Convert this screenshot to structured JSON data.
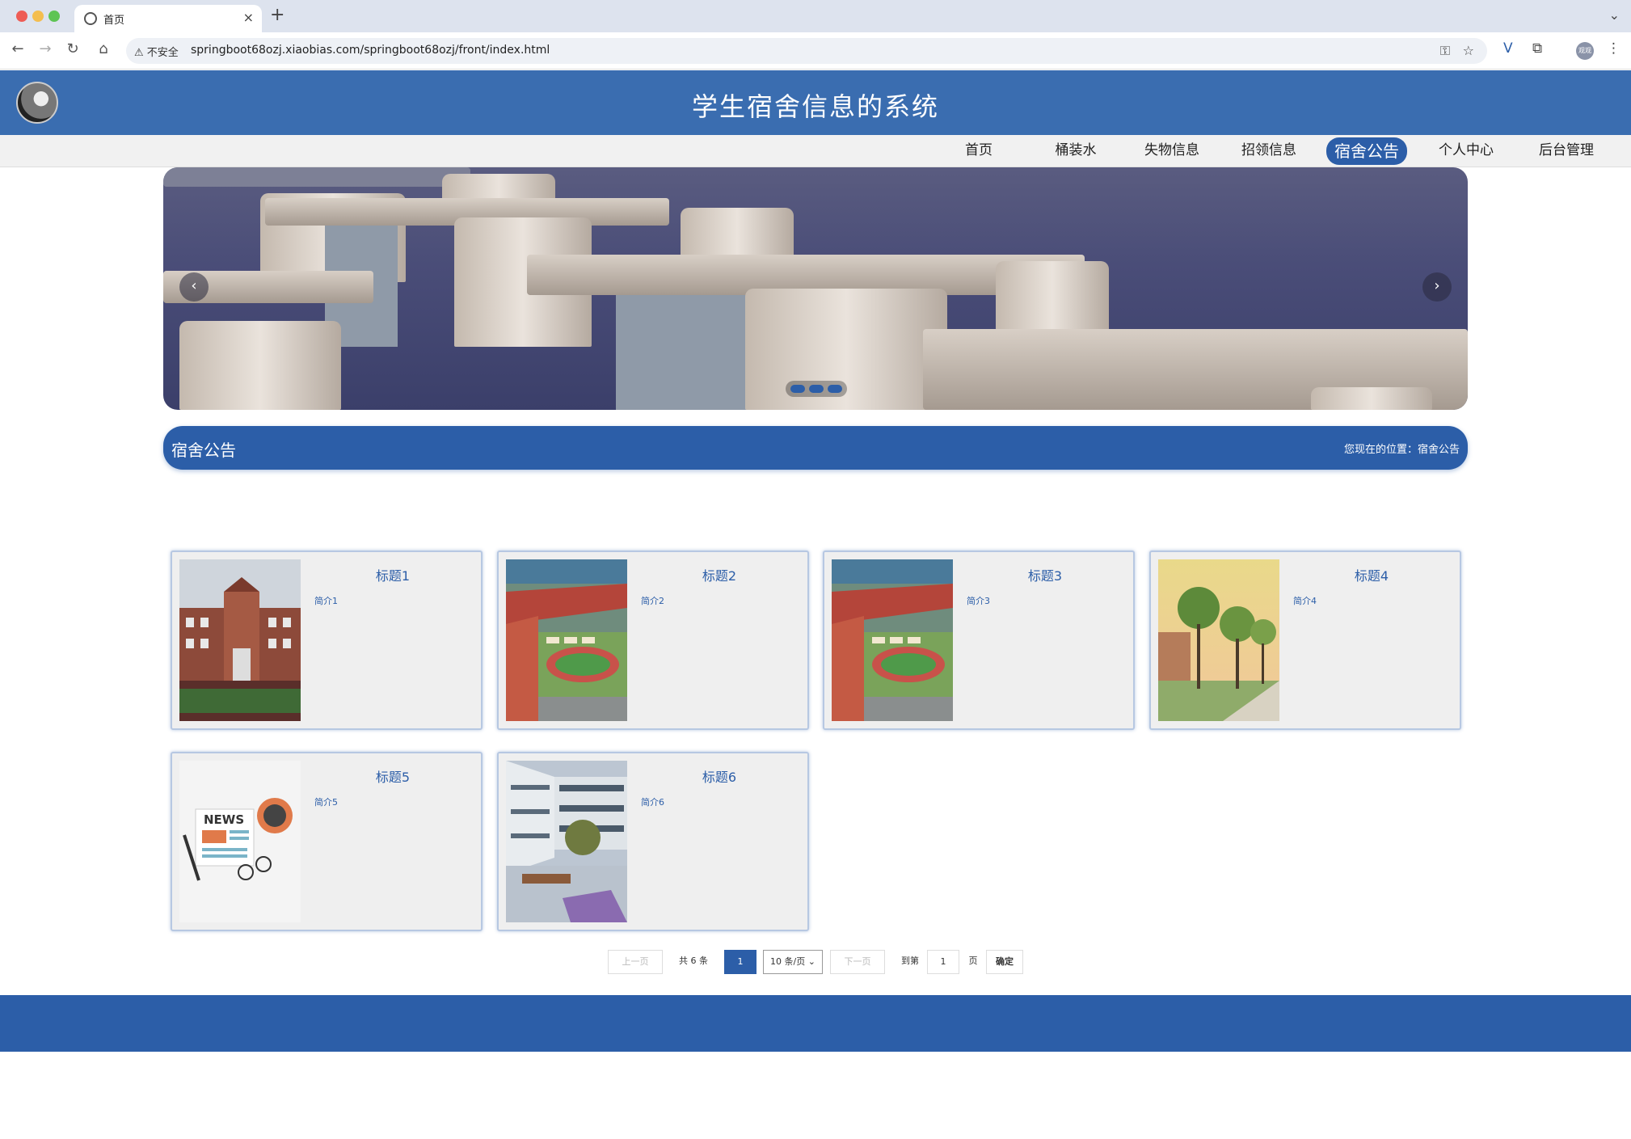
{
  "browser": {
    "tab_title": "首页",
    "close_glyph": "×",
    "new_tab_glyph": "+",
    "menu_glyph": "⌄",
    "security_label": "⚠ 不安全",
    "url": "springboot68ozj.xiaobias.com/springboot68ozj/front/index.html",
    "profile_label": "观观"
  },
  "site": {
    "title": "学生宿舍信息的系统"
  },
  "nav": {
    "items": [
      {
        "label": "首页"
      },
      {
        "label": "桶装水"
      },
      {
        "label": "失物信息"
      },
      {
        "label": "招领信息"
      },
      {
        "label": "宿舍公告"
      },
      {
        "label": "个人中心"
      },
      {
        "label": "后台管理"
      }
    ],
    "active_index": 4
  },
  "banner": {
    "prev_glyph": "‹",
    "next_glyph": "›"
  },
  "section": {
    "title": "宿舍公告",
    "breadcrumb": "您现在的位置：宿舍公告"
  },
  "cards": [
    {
      "title": "标题1",
      "desc": "简介1",
      "image": "school-building"
    },
    {
      "title": "标题2",
      "desc": "简介2",
      "image": "campus-aerial"
    },
    {
      "title": "标题3",
      "desc": "简介3",
      "image": "campus-aerial"
    },
    {
      "title": "标题4",
      "desc": "简介4",
      "image": "tree-lined-path"
    },
    {
      "title": "标题5",
      "desc": "简介5",
      "image": "news-illustration"
    },
    {
      "title": "标题6",
      "desc": "简介6",
      "image": "courtyard"
    }
  ],
  "pagination": {
    "prev_label": "上一页",
    "total_label": "共 6 条",
    "current_page": "1",
    "page_size": "10 条/页",
    "next_label": "下一页",
    "goto_label": "到第",
    "goto_value": "1",
    "page_unit": "页",
    "confirm_label": "确定"
  },
  "colors": {
    "primary": "#2c5ea8",
    "header": "#3a6db0"
  }
}
